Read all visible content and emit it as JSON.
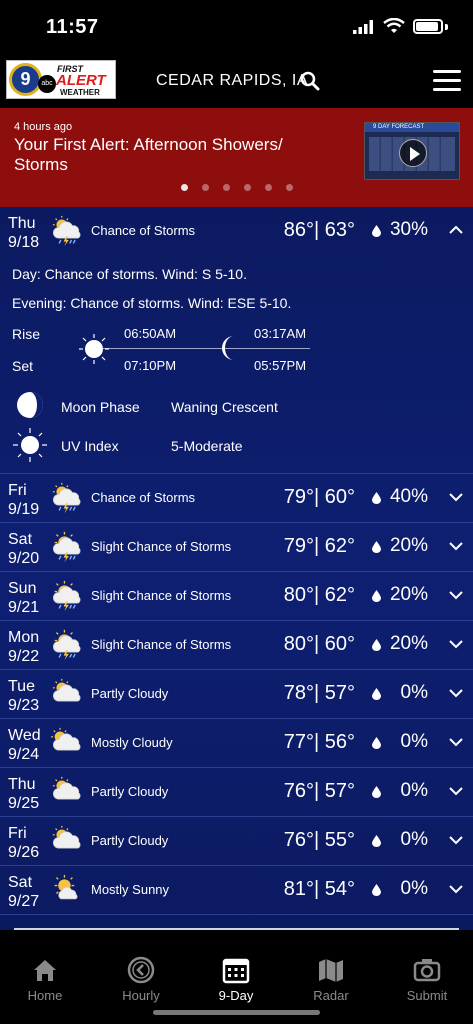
{
  "status_bar": {
    "time": "11:57"
  },
  "header": {
    "logo": {
      "seal_text": "9",
      "network": "abc",
      "line1": "FIRST",
      "line2": "ALERT",
      "line3": "WEATHER"
    },
    "location": "CEDAR RAPIDS, IA"
  },
  "banner": {
    "time_ago": "4 hours ago",
    "headline": "Your First Alert: Afternoon Showers/ Storms",
    "thumbnail_caption": "9 DAY FORECAST",
    "page_count": 6,
    "active_page": 0
  },
  "expanded_day": {
    "day": "Thu",
    "date": "9/18",
    "condition": "Chance of Storms",
    "icon": "storm-icon",
    "high": "86°",
    "low": "63°",
    "precip": "30%",
    "day_text": "Day: Chance of storms. Wind: S 5-10.",
    "evening_text": "Evening: Chance of storms. Wind: ESE 5-10.",
    "rise_label": "Rise",
    "set_label": "Set",
    "sunrise": "06:50AM",
    "sunset": "07:10PM",
    "moonrise": "03:17AM",
    "moonset": "05:57PM",
    "moon_phase_label": "Moon Phase",
    "moon_phase": "Waning Crescent",
    "uv_label": "UV Index",
    "uv_value": "5-Moderate"
  },
  "days": [
    {
      "day": "Fri",
      "date": "9/19",
      "condition": "Chance of Storms",
      "icon": "storm-icon",
      "high": "79°",
      "low": "60°",
      "precip": "40%"
    },
    {
      "day": "Sat",
      "date": "9/20",
      "condition": "Slight Chance of Storms",
      "icon": "sun-storm-icon",
      "high": "79°",
      "low": "62°",
      "precip": "20%"
    },
    {
      "day": "Sun",
      "date": "9/21",
      "condition": "Slight Chance of Storms",
      "icon": "sun-storm-icon",
      "high": "80°",
      "low": "62°",
      "precip": "20%"
    },
    {
      "day": "Mon",
      "date": "9/22",
      "condition": "Slight Chance of Storms",
      "icon": "sun-storm-icon",
      "high": "80°",
      "low": "60°",
      "precip": "20%"
    },
    {
      "day": "Tue",
      "date": "9/23",
      "condition": "Partly Cloudy",
      "icon": "partly-cloudy-icon",
      "high": "78°",
      "low": "57°",
      "precip": "0%"
    },
    {
      "day": "Wed",
      "date": "9/24",
      "condition": "Mostly Cloudy",
      "icon": "mostly-cloudy-icon",
      "high": "77°",
      "low": "56°",
      "precip": "0%"
    },
    {
      "day": "Thu",
      "date": "9/25",
      "condition": "Partly Cloudy",
      "icon": "partly-cloudy-icon",
      "high": "76°",
      "low": "57°",
      "precip": "0%"
    },
    {
      "day": "Fri",
      "date": "9/26",
      "condition": "Partly Cloudy",
      "icon": "partly-cloudy-icon",
      "high": "76°",
      "low": "55°",
      "precip": "0%"
    },
    {
      "day": "Sat",
      "date": "9/27",
      "condition": "Mostly Sunny",
      "icon": "mostly-sunny-icon",
      "high": "81°",
      "low": "54°",
      "precip": "0%"
    }
  ],
  "tabs": [
    {
      "label": "Home",
      "icon": "home-icon",
      "active": false
    },
    {
      "label": "Hourly",
      "icon": "clock-back-icon",
      "active": false
    },
    {
      "label": "9-Day",
      "icon": "calendar-icon",
      "active": true
    },
    {
      "label": "Radar",
      "icon": "map-icon",
      "active": false
    },
    {
      "label": "Submit",
      "icon": "camera-icon",
      "active": false
    }
  ],
  "colors": {
    "banner_red": "#8e0d0d",
    "list_blue": "#0e1f72",
    "tab_inactive": "#8a8a8a"
  }
}
